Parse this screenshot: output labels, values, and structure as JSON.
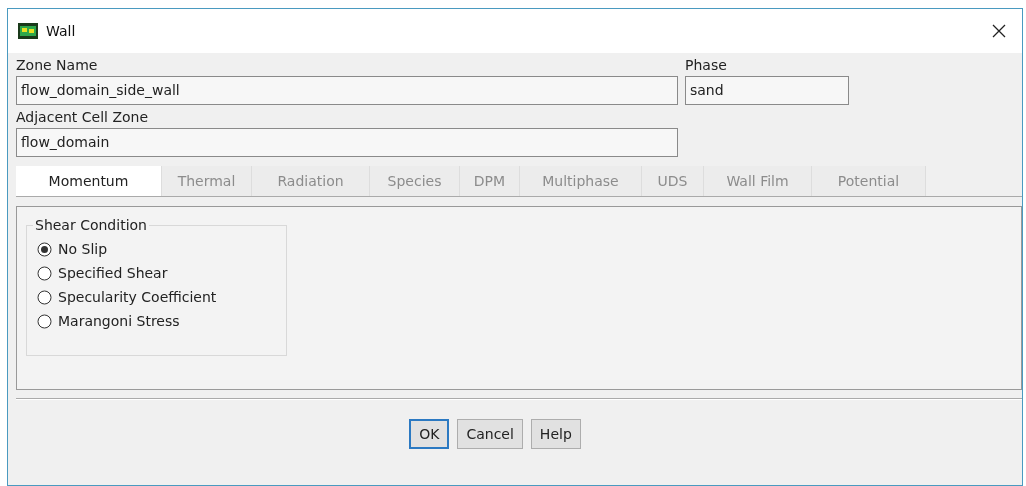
{
  "window": {
    "title": "Wall"
  },
  "zone_name": {
    "label": "Zone Name",
    "value": "flow_domain_side_wall"
  },
  "phase": {
    "label": "Phase",
    "value": "sand"
  },
  "adjacent_cell_zone": {
    "label": "Adjacent Cell Zone",
    "value": "flow_domain"
  },
  "tabs": [
    {
      "label": "Momentum",
      "selected": true,
      "disabled": false
    },
    {
      "label": "Thermal",
      "selected": false,
      "disabled": true
    },
    {
      "label": "Radiation",
      "selected": false,
      "disabled": true
    },
    {
      "label": "Species",
      "selected": false,
      "disabled": true
    },
    {
      "label": "DPM",
      "selected": false,
      "disabled": true
    },
    {
      "label": "Multiphase",
      "selected": false,
      "disabled": true
    },
    {
      "label": "UDS",
      "selected": false,
      "disabled": true
    },
    {
      "label": "Wall Film",
      "selected": false,
      "disabled": true
    },
    {
      "label": "Potential",
      "selected": false,
      "disabled": true
    }
  ],
  "shear_condition": {
    "title": "Shear Condition",
    "options": [
      {
        "label": "No Slip",
        "selected": true
      },
      {
        "label": "Specified Shear",
        "selected": false
      },
      {
        "label": "Specularity Coefficient",
        "selected": false
      },
      {
        "label": "Marangoni Stress",
        "selected": false
      }
    ]
  },
  "buttons": [
    {
      "label": "OK",
      "default": true
    },
    {
      "label": "Cancel",
      "default": false
    },
    {
      "label": "Help",
      "default": false
    }
  ]
}
